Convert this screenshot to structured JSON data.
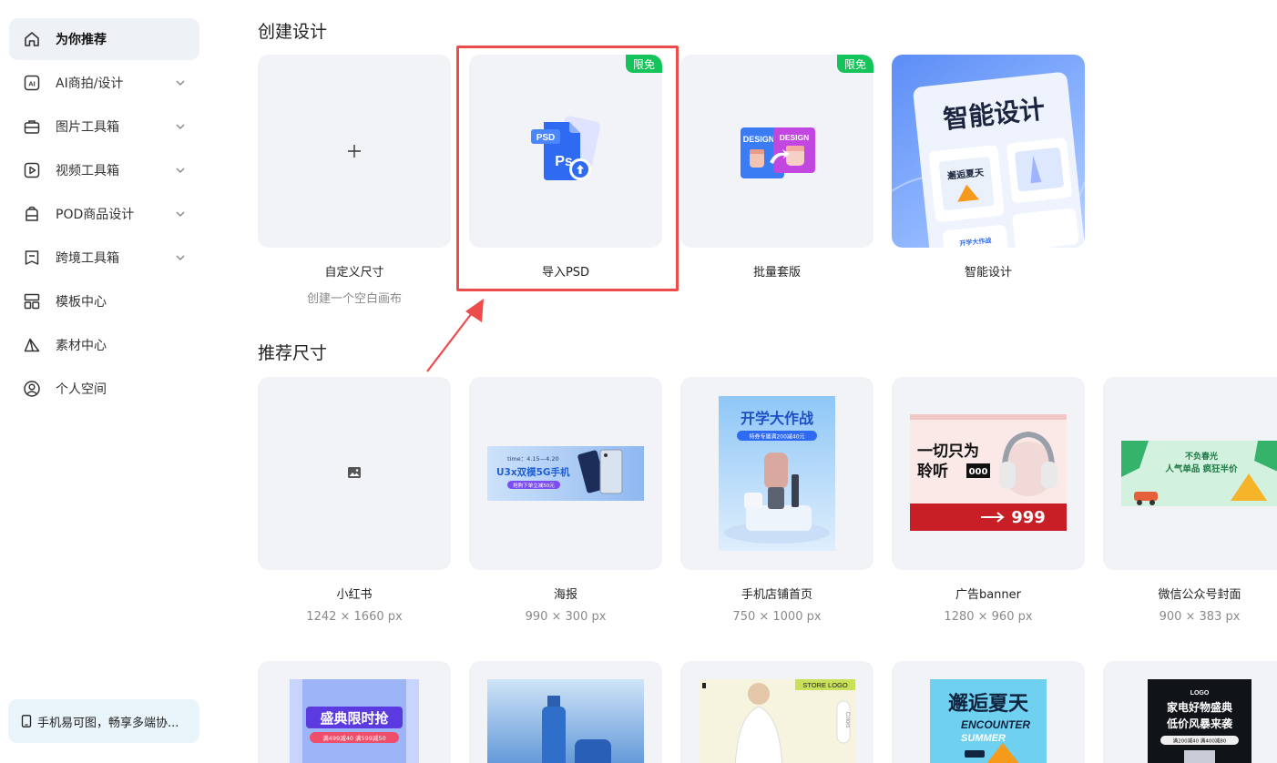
{
  "sidebar": {
    "items": [
      {
        "label": "为你推荐",
        "icon": "home-icon",
        "active": true,
        "expandable": false
      },
      {
        "label": "AI商拍/设计",
        "icon": "ai-icon",
        "active": false,
        "expandable": true
      },
      {
        "label": "图片工具箱",
        "icon": "toolbox-icon",
        "active": false,
        "expandable": true
      },
      {
        "label": "视频工具箱",
        "icon": "video-icon",
        "active": false,
        "expandable": true
      },
      {
        "label": "POD商品设计",
        "icon": "bag-icon",
        "active": false,
        "expandable": true
      },
      {
        "label": "跨境工具箱",
        "icon": "crossborder-icon",
        "active": false,
        "expandable": true
      },
      {
        "label": "模板中心",
        "icon": "template-icon",
        "active": false,
        "expandable": false
      },
      {
        "label": "素材中心",
        "icon": "material-icon",
        "active": false,
        "expandable": false
      },
      {
        "label": "个人空间",
        "icon": "user-icon",
        "active": false,
        "expandable": false
      }
    ],
    "promo": "手机易可图，畅享多端协..."
  },
  "create": {
    "title": "创建设计",
    "cards": [
      {
        "label": "自定义尺寸",
        "sub": "创建一个空白画布",
        "badge": ""
      },
      {
        "label": "导入PSD",
        "sub": "",
        "badge": "限免",
        "thumb_text": [
          "PSD",
          "Ps"
        ]
      },
      {
        "label": "批量套版",
        "sub": "",
        "badge": "限免",
        "thumb_text": [
          "DESIGN",
          "DESIGN"
        ]
      },
      {
        "label": "智能设计",
        "sub": "",
        "badge": "",
        "thumb_text": [
          "智能设计",
          "邂逅夏天",
          "开学大作战"
        ]
      }
    ]
  },
  "recommend": {
    "title": "推荐尺寸",
    "cards": [
      {
        "label": "小红书",
        "size": "1242 × 1660 px"
      },
      {
        "label": "海报",
        "size": "990 × 300 px",
        "thumb_text": [
          "time：4.15—4.20",
          "U3x双模5G手机",
          "抢购下单立减50元"
        ]
      },
      {
        "label": "手机店铺首页",
        "size": "750 × 1000 px",
        "thumb_text": [
          "开学大作战",
          "特券专属满200减40元"
        ]
      },
      {
        "label": "广告banner",
        "size": "1280 × 960 px",
        "thumb_text": [
          "一切只为",
          "聆听",
          "000",
          "999"
        ]
      },
      {
        "label": "微信公众号封面",
        "size": "900 × 383 px",
        "thumb_text": [
          "不负春光",
          "人气单品 疯狂半价"
        ]
      }
    ]
  },
  "more": {
    "cards": [
      {
        "thumb_text": [
          "盛典限时抢",
          "满499减40 满599减50"
        ]
      },
      {
        "thumb_text": []
      },
      {
        "thumb_text": [
          "STORE LOGO",
          "Colors"
        ]
      },
      {
        "thumb_text": [
          "邂逅夏天",
          "ENCOUNTER",
          "SUMMER"
        ]
      },
      {
        "thumb_text": [
          "LOGO",
          "家电好物盛典",
          "低价风暴来袭",
          "满200减40 满400减80"
        ]
      }
    ]
  },
  "colors": {
    "badge": "#14c35a",
    "highlight": "#ee4b4b",
    "card_bg": "#f1f3f7",
    "active_nav": "#eef1f5"
  }
}
